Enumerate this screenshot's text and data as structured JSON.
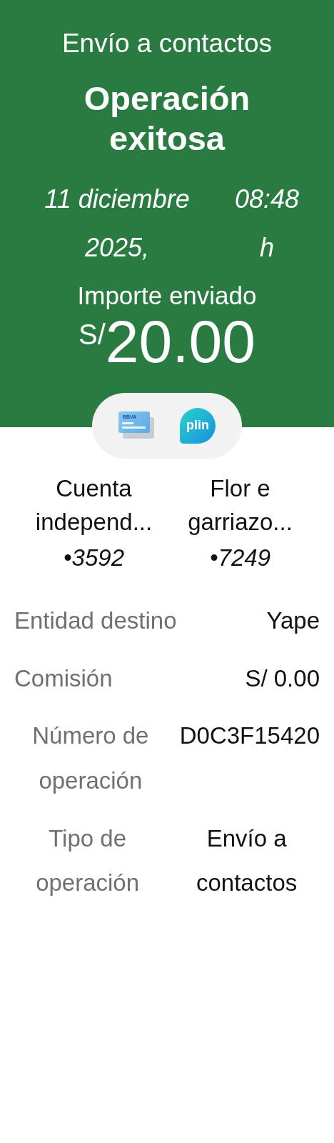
{
  "header": {
    "title": "Envío a contactos",
    "status": "Operación exitosa",
    "date": "11 diciembre 2025,",
    "time": "08:48 h",
    "amount_label": "Importe enviado",
    "currency": "S/",
    "amount": "20.00"
  },
  "logos": [
    {
      "kind": "card",
      "label": "BBVA"
    },
    {
      "kind": "bubble",
      "label": "plin"
    }
  ],
  "accounts": [
    {
      "name": "Cuenta independ...",
      "number": "•3592"
    },
    {
      "name": "Flor e garriazo...",
      "number": "•7249"
    }
  ],
  "details": [
    {
      "label": "Entidad destino",
      "value": "Yape"
    },
    {
      "label": "Comisión",
      "value": "S/ 0.00"
    },
    {
      "label": "Número de operación",
      "value": "D0C3F15420"
    },
    {
      "label": "Tipo de operación",
      "value": "Envío a contactos"
    }
  ]
}
